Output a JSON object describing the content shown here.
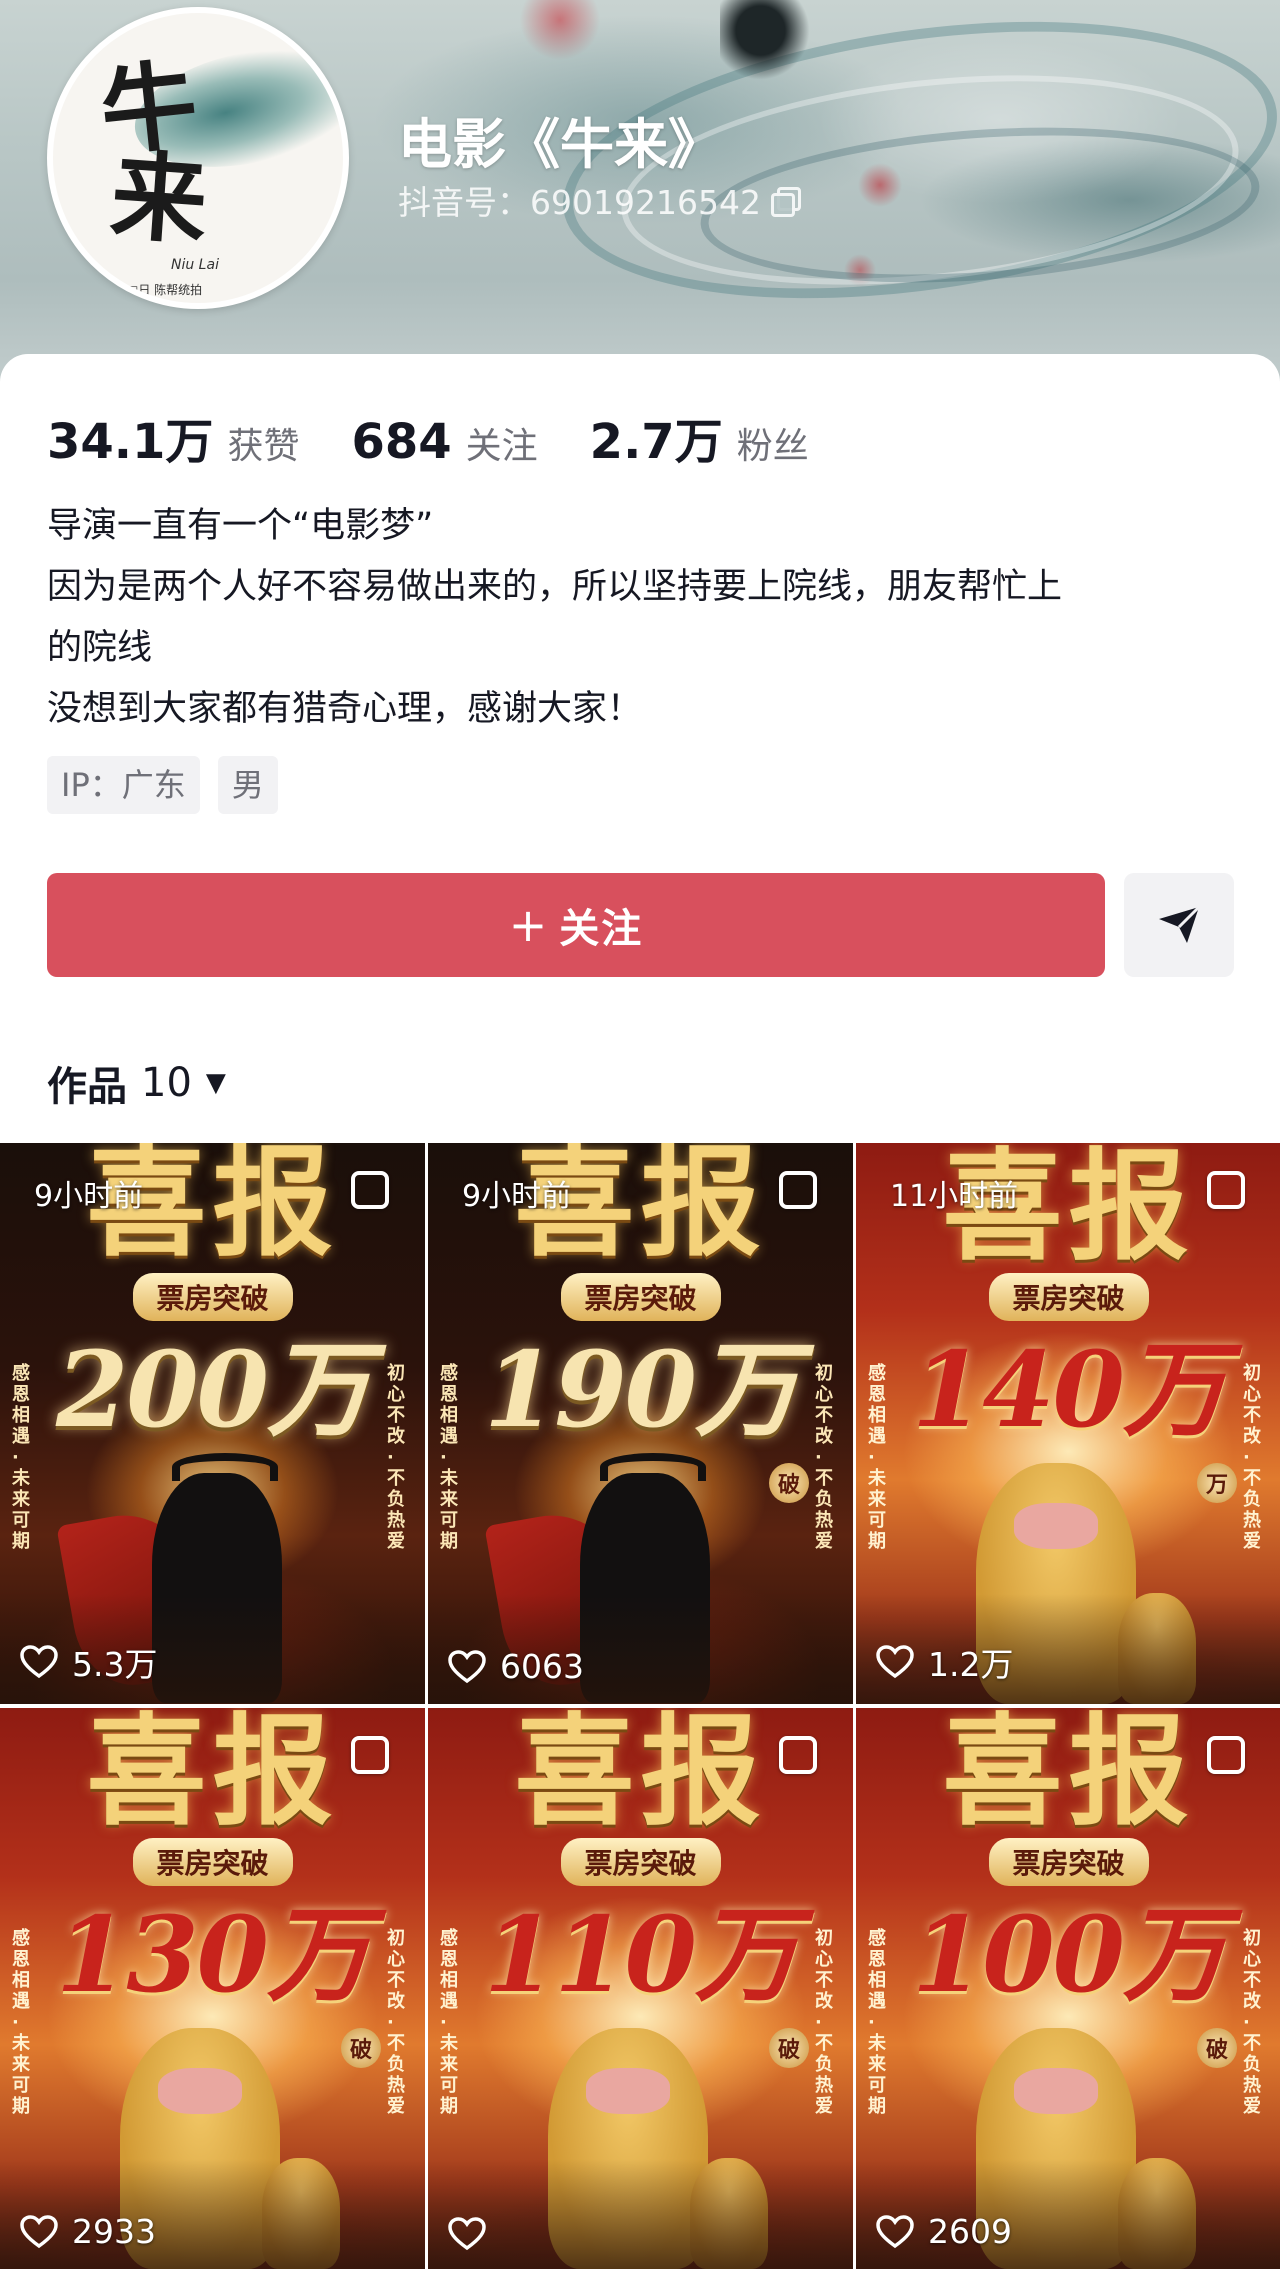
{
  "profile": {
    "name": "电影《牛来》",
    "douyin_id": "抖音号：69019216542",
    "avatar": {
      "glyph_1": "牛",
      "glyph_2": "来",
      "sub": "Niu Lai",
      "footer": "□日  陈帮统拍"
    }
  },
  "stats": [
    {
      "value": "34.1万",
      "label": "获赞"
    },
    {
      "value": "684",
      "label": "关注"
    },
    {
      "value": "2.7万",
      "label": "粉丝"
    }
  ],
  "bio": [
    "导演一直有一个“电影梦”",
    "因为是两个人好不容易做出来的，所以坚持要上院线，朋友帮忙上",
    "的院线",
    "没想到大家都有猎奇心理，感谢大家！"
  ],
  "tags": [
    "IP：广东",
    "男"
  ],
  "actions": {
    "follow_plus": "+",
    "follow_label": "关注"
  },
  "works": {
    "label": "作品",
    "count": "10"
  },
  "poster_common": {
    "title": "喜报",
    "subtitle": "票房突破",
    "left_text": "感恩相遇·未来可期",
    "right_text": "初心不改·不负热爱"
  },
  "videos": [
    {
      "time": "9小时前",
      "likes": "5.3万",
      "amount": "200万",
      "badge": "",
      "style": "dark"
    },
    {
      "time": "9小时前",
      "likes": "6063",
      "amount": "190万",
      "badge": "破",
      "style": "dark"
    },
    {
      "time": "11小时前",
      "likes": "1.2万",
      "amount": "140万",
      "badge": "万",
      "style": "red"
    },
    {
      "time": "",
      "likes": "2933",
      "amount": "130万",
      "badge": "破",
      "style": "red"
    },
    {
      "time": "",
      "likes": "",
      "amount": "110万",
      "badge": "破",
      "style": "red"
    },
    {
      "time": "",
      "likes": "2609",
      "amount": "100万",
      "badge": "破",
      "style": "red"
    }
  ],
  "colors": {
    "follow_button": "#d8505d",
    "text_primary": "#161823",
    "text_secondary": "#6f7078",
    "tag_background": "#f2f2f4"
  }
}
